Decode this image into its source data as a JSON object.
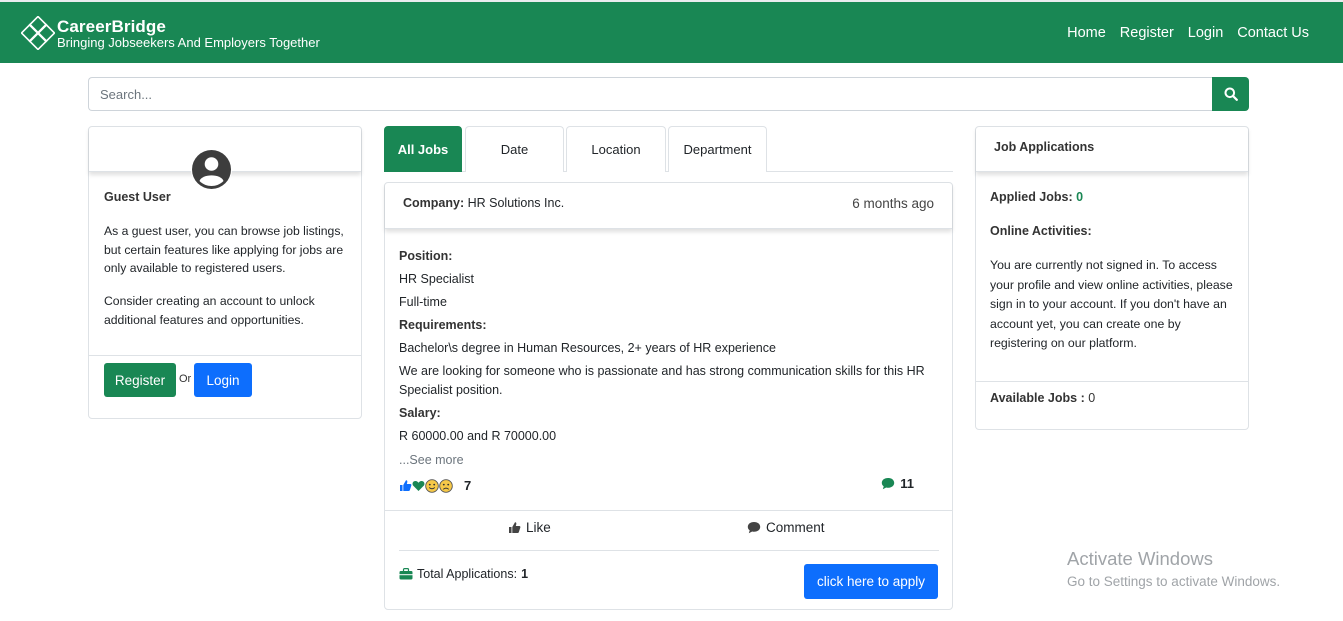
{
  "brand": {
    "name": "CareerBridge",
    "tagline": "Bringing Jobseekers And Employers Together"
  },
  "nav": [
    "Home",
    "Register",
    "Login",
    "Contact Us"
  ],
  "search": {
    "placeholder": "Search...",
    "button_icon": "search-icon"
  },
  "colors": {
    "primary": "#198754",
    "link_blue": "#0d6efd"
  },
  "guest_card": {
    "name": "Guest User",
    "desc1": "As a guest user, you can browse job listings, but certain features like applying for jobs are only available to registered users.",
    "desc2": "Consider creating an account to unlock additional features and opportunities.",
    "register_label": "Register",
    "or_text": "Or",
    "login_label": "Login"
  },
  "tabs": [
    "All Jobs",
    "Date",
    "Location",
    "Department"
  ],
  "job": {
    "company_label": "Company:",
    "company": "HR Solutions Inc.",
    "posted": "6 months ago",
    "position_label": "Position:",
    "position": "HR Specialist",
    "type": "Full-time",
    "requirements_label": "Requirements:",
    "requirements": "Bachelor\\s degree in Human Resources, 2+ years of HR experience",
    "description": "We are looking for someone who is passionate and has strong communication skills for this HR Specialist position.",
    "salary_label": "Salary:",
    "salary": "R 60000.00 and R 70000.00",
    "see_more": "...See more",
    "reaction_count": "7",
    "comment_count": "11",
    "like_label": "Like",
    "comment_label": "Comment",
    "total_applications_label": "Total Applications:",
    "total_applications": "1",
    "apply_label": "click here to apply"
  },
  "applications_card": {
    "title": "Job Applications",
    "applied_label": "Applied Jobs:",
    "applied_count": "0",
    "online_label": "Online Activities:",
    "online_desc": "You are currently not signed in. To access your profile and view online activities, please sign in to your account. If you don't have an account yet, you can create one by registering on our platform.",
    "available_label": "Available Jobs",
    "available_sep": ":",
    "available_count": "0"
  },
  "watermark": {
    "title": "Activate Windows",
    "subtitle": "Go to Settings to activate Windows."
  }
}
